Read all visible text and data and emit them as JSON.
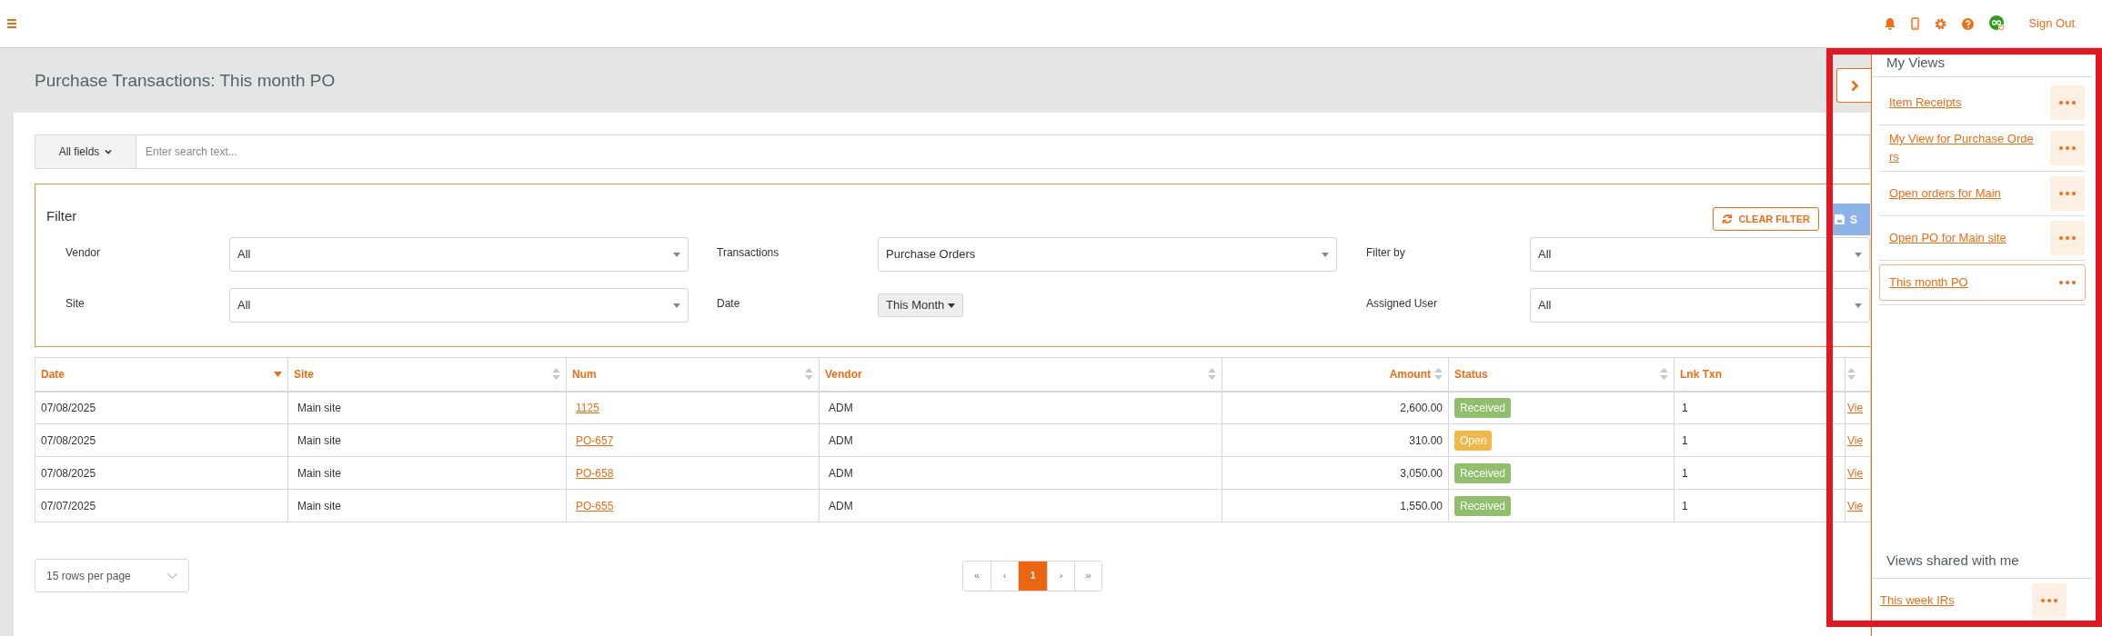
{
  "topbar": {
    "sign_out": "Sign Out"
  },
  "page_title": "Purchase Transactions: This month PO",
  "search": {
    "field_selector": "All fields",
    "placeholder": "Enter search text..."
  },
  "filter": {
    "title": "Filter",
    "clear_button": "CLEAR FILTER",
    "save_button": "S",
    "fields": [
      {
        "label": "Vendor",
        "value": "All",
        "kind": "select"
      },
      {
        "label": "Transactions",
        "value": "Purchase Orders",
        "kind": "select"
      },
      {
        "label": "Filter by",
        "value": "All",
        "kind": "select"
      },
      {
        "label": "Site",
        "value": "All",
        "kind": "select"
      },
      {
        "label": "Date",
        "value": "This Month",
        "kind": "dropdown_button"
      },
      {
        "label": "Assigned User",
        "value": "All",
        "kind": "select"
      }
    ]
  },
  "table": {
    "columns": [
      {
        "label": "Date",
        "sorted_desc": true,
        "sortable": false,
        "right_aligned": false
      },
      {
        "label": "Site",
        "sorted_desc": false,
        "sortable": true,
        "right_aligned": false
      },
      {
        "label": "Num",
        "sorted_desc": false,
        "sortable": true,
        "right_aligned": false
      },
      {
        "label": "Vendor",
        "sorted_desc": false,
        "sortable": true,
        "right_aligned": false
      },
      {
        "label": "Amount",
        "sorted_desc": false,
        "sortable": true,
        "right_aligned": true
      },
      {
        "label": "Status",
        "sorted_desc": false,
        "sortable": true,
        "right_aligned": false
      },
      {
        "label": "Lnk Txn",
        "sorted_desc": false,
        "sortable": false,
        "right_aligned": false
      },
      {
        "sorted_desc": false,
        "sortable": true,
        "right_aligned": false
      }
    ],
    "rows": [
      {
        "date": "07/08/2025",
        "site": "Main site",
        "num": "1125",
        "vendor": "ADM",
        "amount": "2,600.00",
        "status": {
          "text": "Received",
          "color": "#8fbf6a"
        },
        "lnk_txn": "1",
        "link": "Vie"
      },
      {
        "date": "07/08/2025",
        "site": "Main site",
        "num": "PO-657",
        "vendor": "ADM",
        "amount": "310.00",
        "status": {
          "text": "Open",
          "color": "#f0b849"
        },
        "lnk_txn": "1",
        "link": "Vie"
      },
      {
        "date": "07/08/2025",
        "site": "Main site",
        "num": "PO-658",
        "vendor": "ADM",
        "amount": "3,050.00",
        "status": {
          "text": "Received",
          "color": "#8fbf6a"
        },
        "lnk_txn": "1",
        "link": "Vie"
      },
      {
        "date": "07/07/2025",
        "site": "Main site",
        "num": "PO-655",
        "vendor": "ADM",
        "amount": "1,550.00",
        "status": {
          "text": "Received",
          "color": "#8fbf6a"
        },
        "lnk_txn": "1",
        "link": "Vie"
      }
    ]
  },
  "rows_per_page": "15 rows per page",
  "pagination": [
    {
      "label": "«",
      "selected": false
    },
    {
      "label": "‹",
      "selected": false
    },
    {
      "label": "1",
      "selected": true
    },
    {
      "label": "›",
      "selected": false
    },
    {
      "label": "»",
      "selected": false
    }
  ],
  "views_panel": {
    "title": "My Views",
    "my_views": [
      {
        "label": "Item Receipts",
        "selected": false
      },
      {
        "label": "My View for Purchase Orders",
        "selected": false
      },
      {
        "label": "Open orders for Main",
        "selected": false
      },
      {
        "label": "Open PO for Main site",
        "selected": false
      },
      {
        "label": "This month PO",
        "selected": true
      }
    ],
    "shared_title": "Views shared with me",
    "shared_views": [
      {
        "label": "This week IRs",
        "selected": false
      }
    ]
  }
}
